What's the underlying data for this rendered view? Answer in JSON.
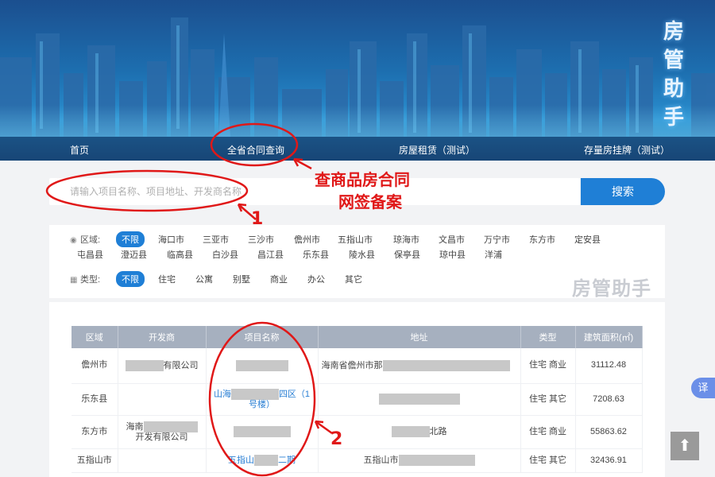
{
  "banner": {
    "brand": "房管助手",
    "nav": [
      {
        "label": "首页"
      },
      {
        "label": "全省合同查询"
      },
      {
        "label": "房屋租赁（测试）"
      },
      {
        "label": "存量房挂牌（测试）"
      }
    ]
  },
  "search": {
    "placeholder": "请输入项目名称、项目地址、开发商名称",
    "button": "搜索"
  },
  "filters": {
    "region_label": "区域:",
    "region_options": [
      "不限",
      "海口市",
      "三亚市",
      "三沙市",
      "儋州市",
      "五指山市",
      "琼海市",
      "文昌市",
      "万宁市",
      "东方市",
      "定安县",
      "屯昌县",
      "澄迈县",
      "临高县",
      "白沙县",
      "昌江县",
      "乐东县",
      "陵水县",
      "保亭县",
      "琼中县",
      "洋浦"
    ],
    "type_label": "类型:",
    "type_options": [
      "不限",
      "住宅",
      "公寓",
      "别墅",
      "商业",
      "办公",
      "其它"
    ],
    "watermark": "房管助手"
  },
  "table": {
    "headers": [
      "区域",
      "开发商",
      "项目名称",
      "地址",
      "类型",
      "建筑面积(㎡)"
    ],
    "rows": [
      {
        "region": "儋州市",
        "developer": "有限公司",
        "project": "",
        "address": "海南省儋州市那",
        "type": "住宅 商业",
        "area": "31112.48"
      },
      {
        "region": "乐东县",
        "developer": "",
        "project": "山海",
        "project_tail": "四区（1号楼）",
        "address": "",
        "type": "住宅 其它",
        "area": "7208.63"
      },
      {
        "region": "东方市",
        "developer": "海南",
        "developer_tail": "开发有限公司",
        "project": "",
        "address": "北路",
        "type": "住宅 商业",
        "area": "55863.62"
      },
      {
        "region": "五指山市",
        "developer": "",
        "project": "五指山",
        "project_tail": "二期",
        "address": "五指山市",
        "type": "住宅 其它",
        "area": "32436.91"
      }
    ]
  },
  "annotations": {
    "title_line1": "查商品房合同",
    "title_line2": "网签备案",
    "marker1": "1",
    "marker2": "2",
    "color": "#e01818"
  },
  "floating": {
    "translate": "译",
    "back_to_top": "⬆"
  }
}
